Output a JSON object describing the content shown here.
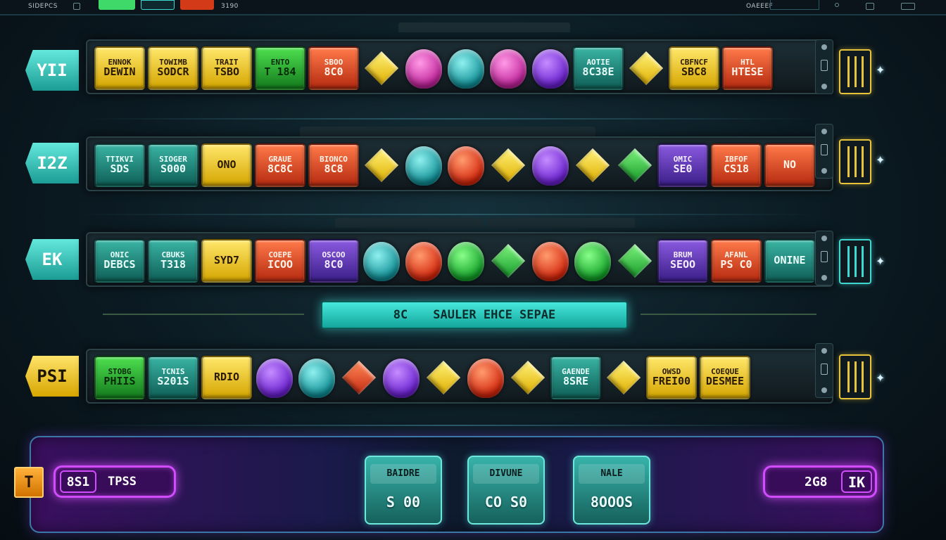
{
  "topbar": {
    "left_label": "SIDEPCS",
    "mid_label": "3190",
    "right_label": "OAEEEF"
  },
  "rows": [
    {
      "label": "YII",
      "label_color": "teal",
      "tiles": [
        {
          "kind": "tile",
          "color": "yellow",
          "line1": "ENNOK",
          "line2": "DEWIN"
        },
        {
          "kind": "tile",
          "color": "yellow",
          "line1": "TOWIMB",
          "line2": "SODCR"
        },
        {
          "kind": "tile",
          "color": "yellow",
          "line1": "TRAIT",
          "line2": "TSBO"
        },
        {
          "kind": "tile",
          "color": "green",
          "line1": "ENTO",
          "line2": "T 184"
        },
        {
          "kind": "tile",
          "color": "red",
          "line1": "SBOO",
          "line2": "8C0"
        },
        {
          "kind": "cube",
          "color": "yellow"
        },
        {
          "kind": "gem",
          "color": "pink"
        },
        {
          "kind": "gem",
          "color": "teal"
        },
        {
          "kind": "gem",
          "color": "pink"
        },
        {
          "kind": "gem",
          "color": "purple"
        },
        {
          "kind": "tile",
          "color": "teal",
          "line1": "AOTIE",
          "line2": "8C38E"
        },
        {
          "kind": "cube",
          "color": "yellow"
        },
        {
          "kind": "tile",
          "color": "yellow",
          "line1": "CBFNCF",
          "line2": "SBC8"
        },
        {
          "kind": "tile",
          "color": "red",
          "line1": "HTL",
          "line2": "HTESE"
        }
      ]
    },
    {
      "label": "I2Z",
      "label_color": "teal",
      "tiles": [
        {
          "kind": "tile",
          "color": "teal",
          "line1": "TTIKVI",
          "line2": "SDS"
        },
        {
          "kind": "tile",
          "color": "teal",
          "line1": "SIOGER",
          "line2": "S000"
        },
        {
          "kind": "tile",
          "color": "yellow",
          "line1": "",
          "line2": "ONO"
        },
        {
          "kind": "tile",
          "color": "red",
          "line1": "GRAUE",
          "line2": "8C8C"
        },
        {
          "kind": "tile",
          "color": "red",
          "line1": "BIONCO",
          "line2": "8C8"
        },
        {
          "kind": "cube",
          "color": "yellow"
        },
        {
          "kind": "gem",
          "color": "teal"
        },
        {
          "kind": "gem",
          "color": "red"
        },
        {
          "kind": "cube",
          "color": "yellow"
        },
        {
          "kind": "gem",
          "color": "purple"
        },
        {
          "kind": "cube",
          "color": "yellow"
        },
        {
          "kind": "cube",
          "color": "green"
        },
        {
          "kind": "tile",
          "color": "purple",
          "line1": "OMIC",
          "line2": "SE0"
        },
        {
          "kind": "tile",
          "color": "red",
          "line1": "IBFOF",
          "line2": "CS18"
        },
        {
          "kind": "tile",
          "color": "red",
          "line1": "",
          "line2": "NO"
        }
      ]
    },
    {
      "label": "EK",
      "label_color": "teal",
      "tiles": [
        {
          "kind": "tile",
          "color": "teal",
          "line1": "ONIC",
          "line2": "DEBCS"
        },
        {
          "kind": "tile",
          "color": "teal",
          "line1": "CBUKS",
          "line2": "T318"
        },
        {
          "kind": "tile",
          "color": "yellow",
          "line1": "",
          "line2": "SYD7"
        },
        {
          "kind": "tile",
          "color": "red",
          "line1": "COEPE",
          "line2": "ICOO"
        },
        {
          "kind": "tile",
          "color": "purple",
          "line1": "OSCOO",
          "line2": "8C0"
        },
        {
          "kind": "gem",
          "color": "teal"
        },
        {
          "kind": "gem",
          "color": "red"
        },
        {
          "kind": "gem",
          "color": "green"
        },
        {
          "kind": "cube",
          "color": "green"
        },
        {
          "kind": "gem",
          "color": "red"
        },
        {
          "kind": "gem",
          "color": "green"
        },
        {
          "kind": "cube",
          "color": "green"
        },
        {
          "kind": "tile",
          "color": "purple",
          "line1": "BRUM",
          "line2": "SEOO"
        },
        {
          "kind": "tile",
          "color": "red",
          "line1": "AFANL",
          "line2": "PS C0"
        },
        {
          "kind": "tile",
          "color": "teal",
          "line1": "",
          "line2": "ONINE"
        }
      ]
    },
    {
      "label": "PSI",
      "label_color": "yellow",
      "tiles": [
        {
          "kind": "tile",
          "color": "green",
          "line1": "STOBG",
          "line2": "PHIIS"
        },
        {
          "kind": "tile",
          "color": "teal",
          "line1": "TCNIS",
          "line2": "S201S"
        },
        {
          "kind": "tile",
          "color": "yellow",
          "line1": "",
          "line2": "RDIO"
        },
        {
          "kind": "gem",
          "color": "purple"
        },
        {
          "kind": "gem",
          "color": "teal"
        },
        {
          "kind": "cube",
          "color": "red"
        },
        {
          "kind": "gem",
          "color": "purple"
        },
        {
          "kind": "cube",
          "color": "yellow"
        },
        {
          "kind": "gem",
          "color": "red"
        },
        {
          "kind": "cube",
          "color": "yellow"
        },
        {
          "kind": "tile",
          "color": "teal",
          "line1": "GAENDE",
          "line2": "8SRE"
        },
        {
          "kind": "cube",
          "color": "yellow"
        },
        {
          "kind": "tile",
          "color": "yellow",
          "line1": "OWSD",
          "line2": "FREI00"
        },
        {
          "kind": "tile",
          "color": "yellow",
          "line1": "COEQUE",
          "line2": "DESMEE"
        }
      ]
    }
  ],
  "banner": {
    "left": "8C",
    "right": "SAULER EHCE SEPAE"
  },
  "bottom": {
    "square_label": "T",
    "left_display": {
      "value": "8S1",
      "label": "TPSS"
    },
    "right_display": {
      "value": "2G8",
      "label": "IK"
    },
    "stats": [
      {
        "label": "BAIDRE",
        "value": "S 00"
      },
      {
        "label": "DIVUNE",
        "value": "CO S0"
      },
      {
        "label": "NALE",
        "value": "8OOOS"
      }
    ]
  },
  "colors": {
    "accent_teal": "#3fd8d0",
    "accent_yellow": "#e8c43a",
    "neon_purple": "#d24cff"
  }
}
